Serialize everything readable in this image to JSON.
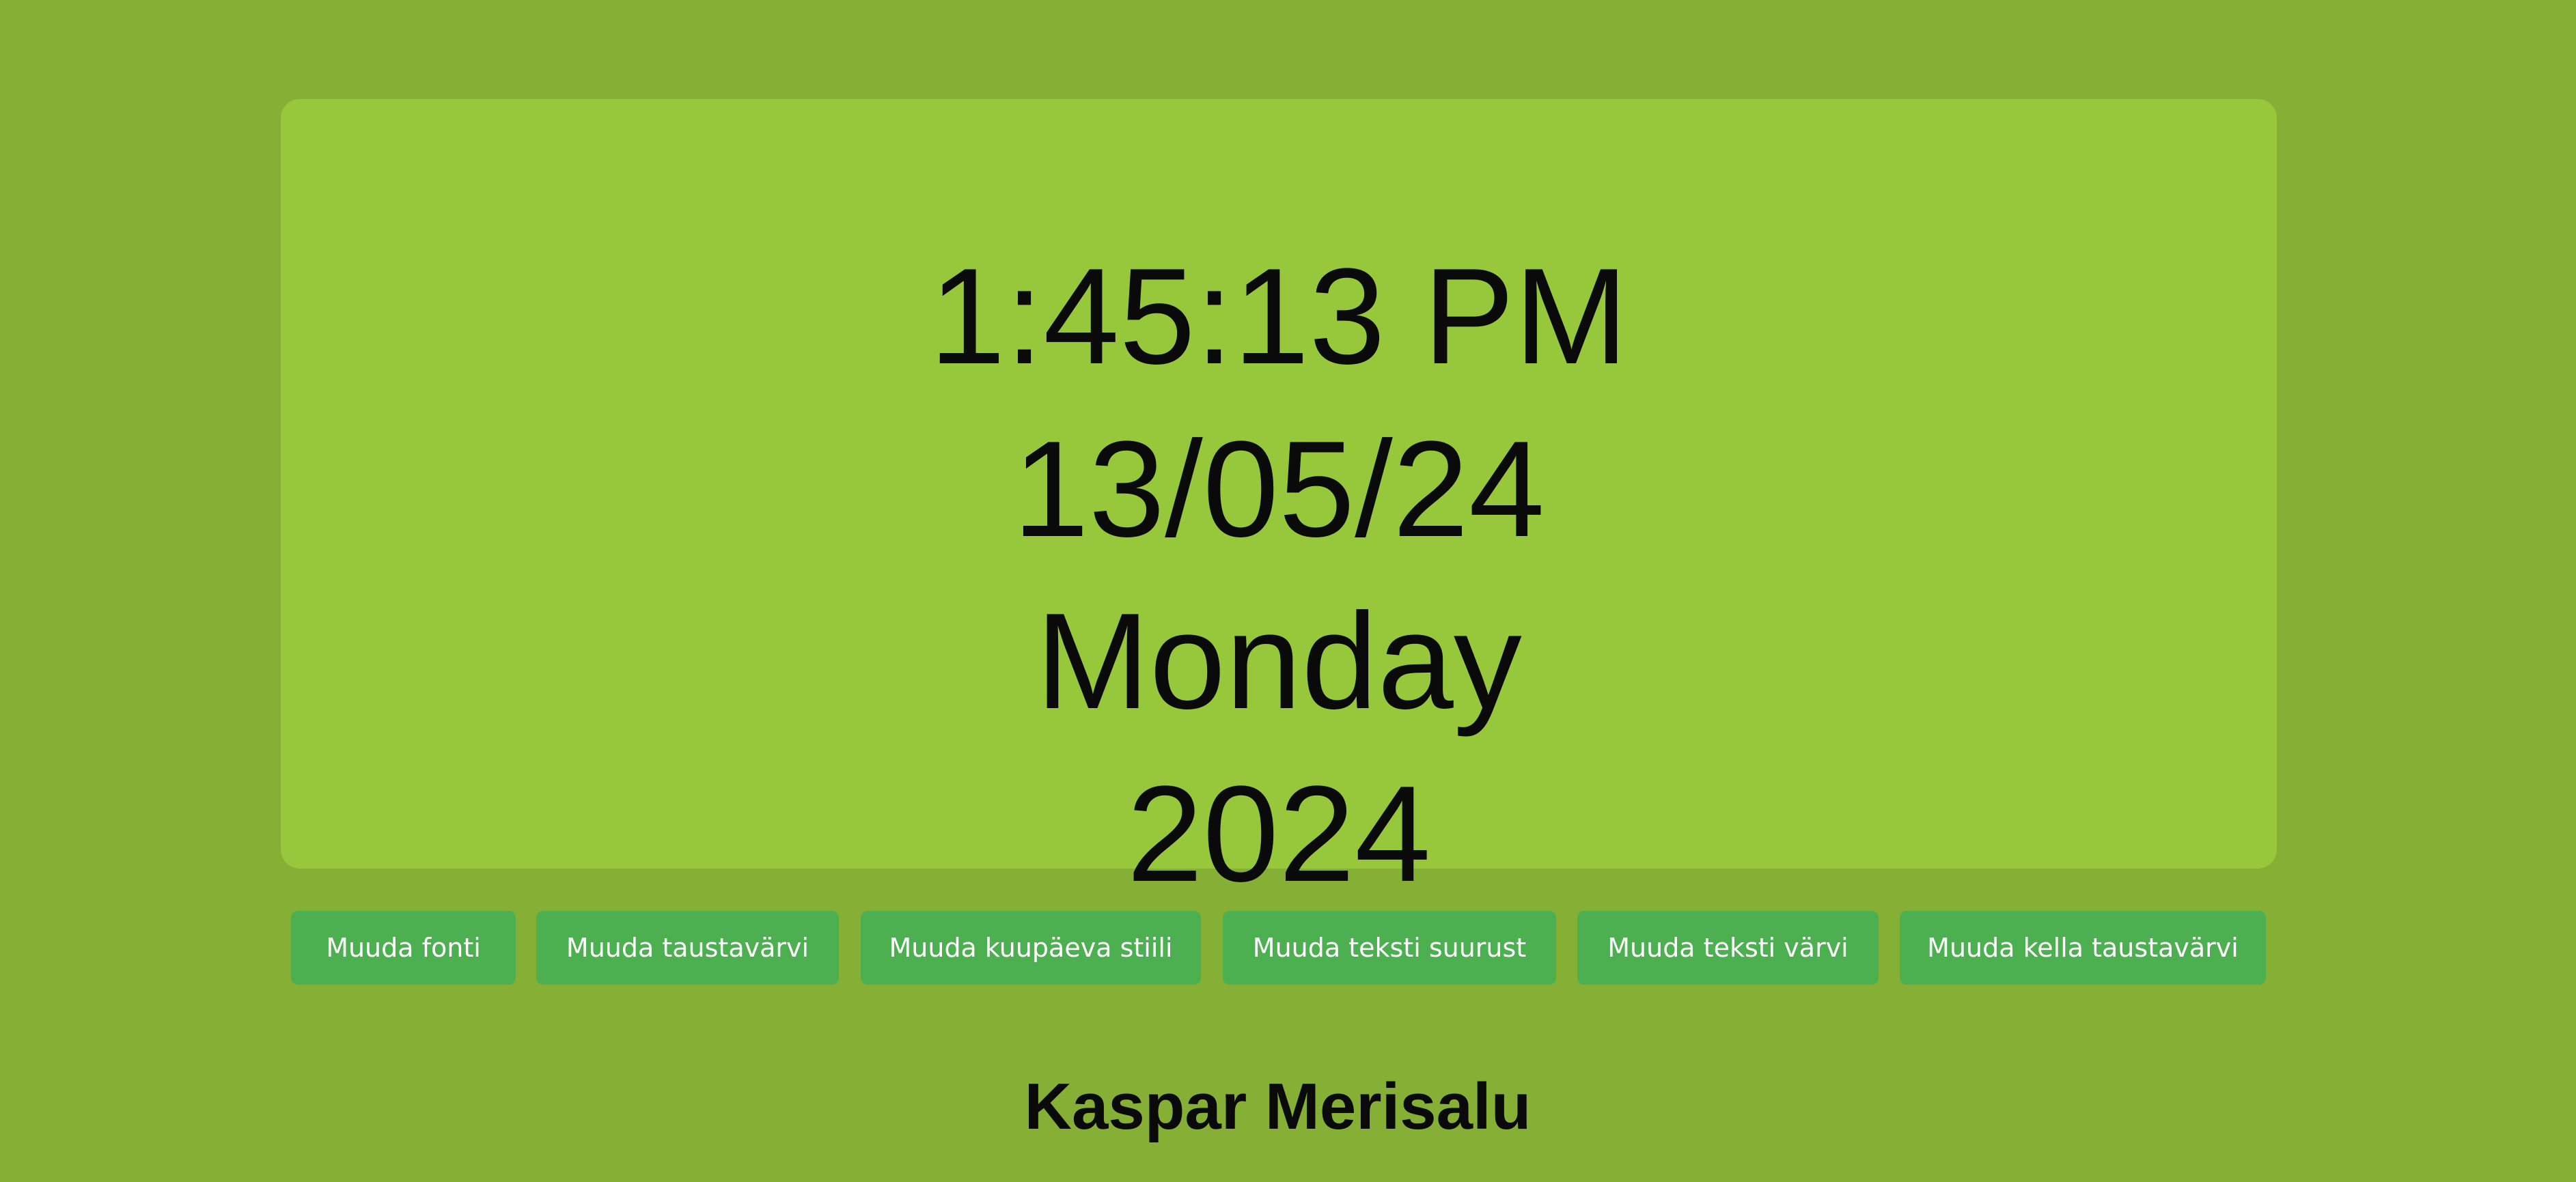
{
  "clock": {
    "time": "1:45:13 PM",
    "date": "13/05/24",
    "weekday": "Monday",
    "year": "2024"
  },
  "buttons": {
    "change_font": "Muuda fonti",
    "change_background_color": "Muuda taustavärvi",
    "change_date_style": "Muuda kuupäeva stiili",
    "change_text_size": "Muuda teksti suurust",
    "change_text_color": "Muuda teksti värvi",
    "change_clock_background": "Muuda kella taustavärvi"
  },
  "author": "Kaspar Merisalu",
  "colors": {
    "page_background": "#85b035",
    "clock_background": "#97c83b",
    "button_background": "#4caf50",
    "button_text": "#ffffff",
    "text": "#0a0a0a"
  }
}
